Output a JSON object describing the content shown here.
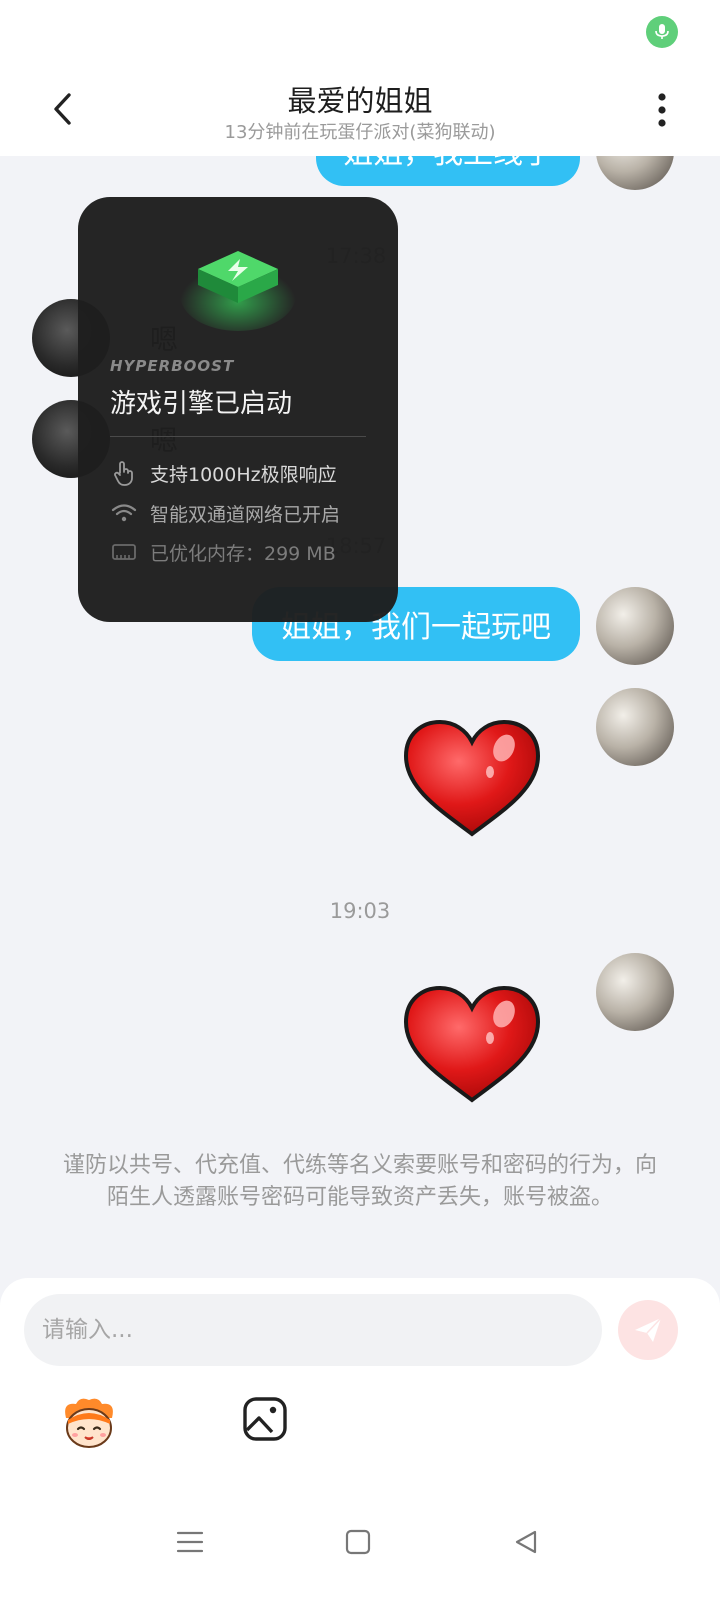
{
  "header": {
    "title": "最爱的姐姐",
    "subtitle": "13分钟前在玩蛋仔派对(菜狗联动)"
  },
  "messages": {
    "m1_text": "姐姐，我上线了",
    "time1": "17:38",
    "her1": "嗯",
    "her2": "嗯",
    "time2": "18:57",
    "m2_text": "姐姐，我们一起玩吧",
    "time3": "19:03"
  },
  "boost": {
    "brand": "HYPERBOOST",
    "title": "游戏引擎已启动",
    "items": [
      {
        "icon": "touch-icon",
        "text": "支持1000Hz极限响应"
      },
      {
        "icon": "wifi-icon",
        "text": "智能双通道网络已开启"
      },
      {
        "icon": "memory-icon",
        "text": "已优化内存：299 MB"
      }
    ]
  },
  "notice": "谨防以共号、代充值、代练等名义索要账号和密码的行为，向陌生人透露账号密码可能导致资产丢失，账号被盗。",
  "input": {
    "placeholder": "请输入..."
  },
  "colors": {
    "bubble": "#32c0f4",
    "status_green": "#5fcf7a",
    "send_bg": "#fde3e3"
  }
}
